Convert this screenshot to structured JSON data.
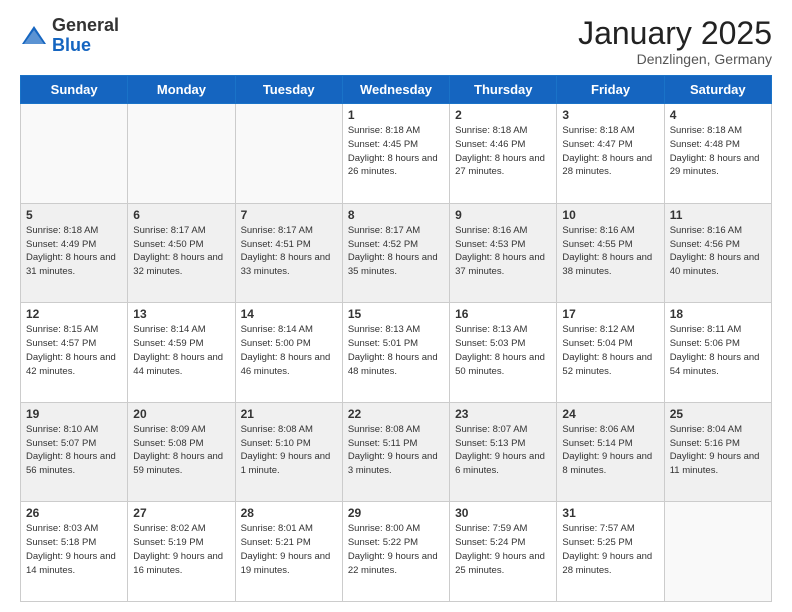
{
  "logo": {
    "general": "General",
    "blue": "Blue"
  },
  "header": {
    "month": "January 2025",
    "location": "Denzlingen, Germany"
  },
  "weekdays": [
    "Sunday",
    "Monday",
    "Tuesday",
    "Wednesday",
    "Thursday",
    "Friday",
    "Saturday"
  ],
  "weeks": [
    [
      {
        "day": "",
        "info": "",
        "empty": true
      },
      {
        "day": "",
        "info": "",
        "empty": true
      },
      {
        "day": "",
        "info": "",
        "empty": true
      },
      {
        "day": "1",
        "info": "Sunrise: 8:18 AM\nSunset: 4:45 PM\nDaylight: 8 hours and 26 minutes."
      },
      {
        "day": "2",
        "info": "Sunrise: 8:18 AM\nSunset: 4:46 PM\nDaylight: 8 hours and 27 minutes."
      },
      {
        "day": "3",
        "info": "Sunrise: 8:18 AM\nSunset: 4:47 PM\nDaylight: 8 hours and 28 minutes."
      },
      {
        "day": "4",
        "info": "Sunrise: 8:18 AM\nSunset: 4:48 PM\nDaylight: 8 hours and 29 minutes."
      }
    ],
    [
      {
        "day": "5",
        "info": "Sunrise: 8:18 AM\nSunset: 4:49 PM\nDaylight: 8 hours and 31 minutes."
      },
      {
        "day": "6",
        "info": "Sunrise: 8:17 AM\nSunset: 4:50 PM\nDaylight: 8 hours and 32 minutes."
      },
      {
        "day": "7",
        "info": "Sunrise: 8:17 AM\nSunset: 4:51 PM\nDaylight: 8 hours and 33 minutes."
      },
      {
        "day": "8",
        "info": "Sunrise: 8:17 AM\nSunset: 4:52 PM\nDaylight: 8 hours and 35 minutes."
      },
      {
        "day": "9",
        "info": "Sunrise: 8:16 AM\nSunset: 4:53 PM\nDaylight: 8 hours and 37 minutes."
      },
      {
        "day": "10",
        "info": "Sunrise: 8:16 AM\nSunset: 4:55 PM\nDaylight: 8 hours and 38 minutes."
      },
      {
        "day": "11",
        "info": "Sunrise: 8:16 AM\nSunset: 4:56 PM\nDaylight: 8 hours and 40 minutes."
      }
    ],
    [
      {
        "day": "12",
        "info": "Sunrise: 8:15 AM\nSunset: 4:57 PM\nDaylight: 8 hours and 42 minutes."
      },
      {
        "day": "13",
        "info": "Sunrise: 8:14 AM\nSunset: 4:59 PM\nDaylight: 8 hours and 44 minutes."
      },
      {
        "day": "14",
        "info": "Sunrise: 8:14 AM\nSunset: 5:00 PM\nDaylight: 8 hours and 46 minutes."
      },
      {
        "day": "15",
        "info": "Sunrise: 8:13 AM\nSunset: 5:01 PM\nDaylight: 8 hours and 48 minutes."
      },
      {
        "day": "16",
        "info": "Sunrise: 8:13 AM\nSunset: 5:03 PM\nDaylight: 8 hours and 50 minutes."
      },
      {
        "day": "17",
        "info": "Sunrise: 8:12 AM\nSunset: 5:04 PM\nDaylight: 8 hours and 52 minutes."
      },
      {
        "day": "18",
        "info": "Sunrise: 8:11 AM\nSunset: 5:06 PM\nDaylight: 8 hours and 54 minutes."
      }
    ],
    [
      {
        "day": "19",
        "info": "Sunrise: 8:10 AM\nSunset: 5:07 PM\nDaylight: 8 hours and 56 minutes."
      },
      {
        "day": "20",
        "info": "Sunrise: 8:09 AM\nSunset: 5:08 PM\nDaylight: 8 hours and 59 minutes."
      },
      {
        "day": "21",
        "info": "Sunrise: 8:08 AM\nSunset: 5:10 PM\nDaylight: 9 hours and 1 minute."
      },
      {
        "day": "22",
        "info": "Sunrise: 8:08 AM\nSunset: 5:11 PM\nDaylight: 9 hours and 3 minutes."
      },
      {
        "day": "23",
        "info": "Sunrise: 8:07 AM\nSunset: 5:13 PM\nDaylight: 9 hours and 6 minutes."
      },
      {
        "day": "24",
        "info": "Sunrise: 8:06 AM\nSunset: 5:14 PM\nDaylight: 9 hours and 8 minutes."
      },
      {
        "day": "25",
        "info": "Sunrise: 8:04 AM\nSunset: 5:16 PM\nDaylight: 9 hours and 11 minutes."
      }
    ],
    [
      {
        "day": "26",
        "info": "Sunrise: 8:03 AM\nSunset: 5:18 PM\nDaylight: 9 hours and 14 minutes."
      },
      {
        "day": "27",
        "info": "Sunrise: 8:02 AM\nSunset: 5:19 PM\nDaylight: 9 hours and 16 minutes."
      },
      {
        "day": "28",
        "info": "Sunrise: 8:01 AM\nSunset: 5:21 PM\nDaylight: 9 hours and 19 minutes."
      },
      {
        "day": "29",
        "info": "Sunrise: 8:00 AM\nSunset: 5:22 PM\nDaylight: 9 hours and 22 minutes."
      },
      {
        "day": "30",
        "info": "Sunrise: 7:59 AM\nSunset: 5:24 PM\nDaylight: 9 hours and 25 minutes."
      },
      {
        "day": "31",
        "info": "Sunrise: 7:57 AM\nSunset: 5:25 PM\nDaylight: 9 hours and 28 minutes."
      },
      {
        "day": "",
        "info": "",
        "empty": true
      }
    ]
  ]
}
